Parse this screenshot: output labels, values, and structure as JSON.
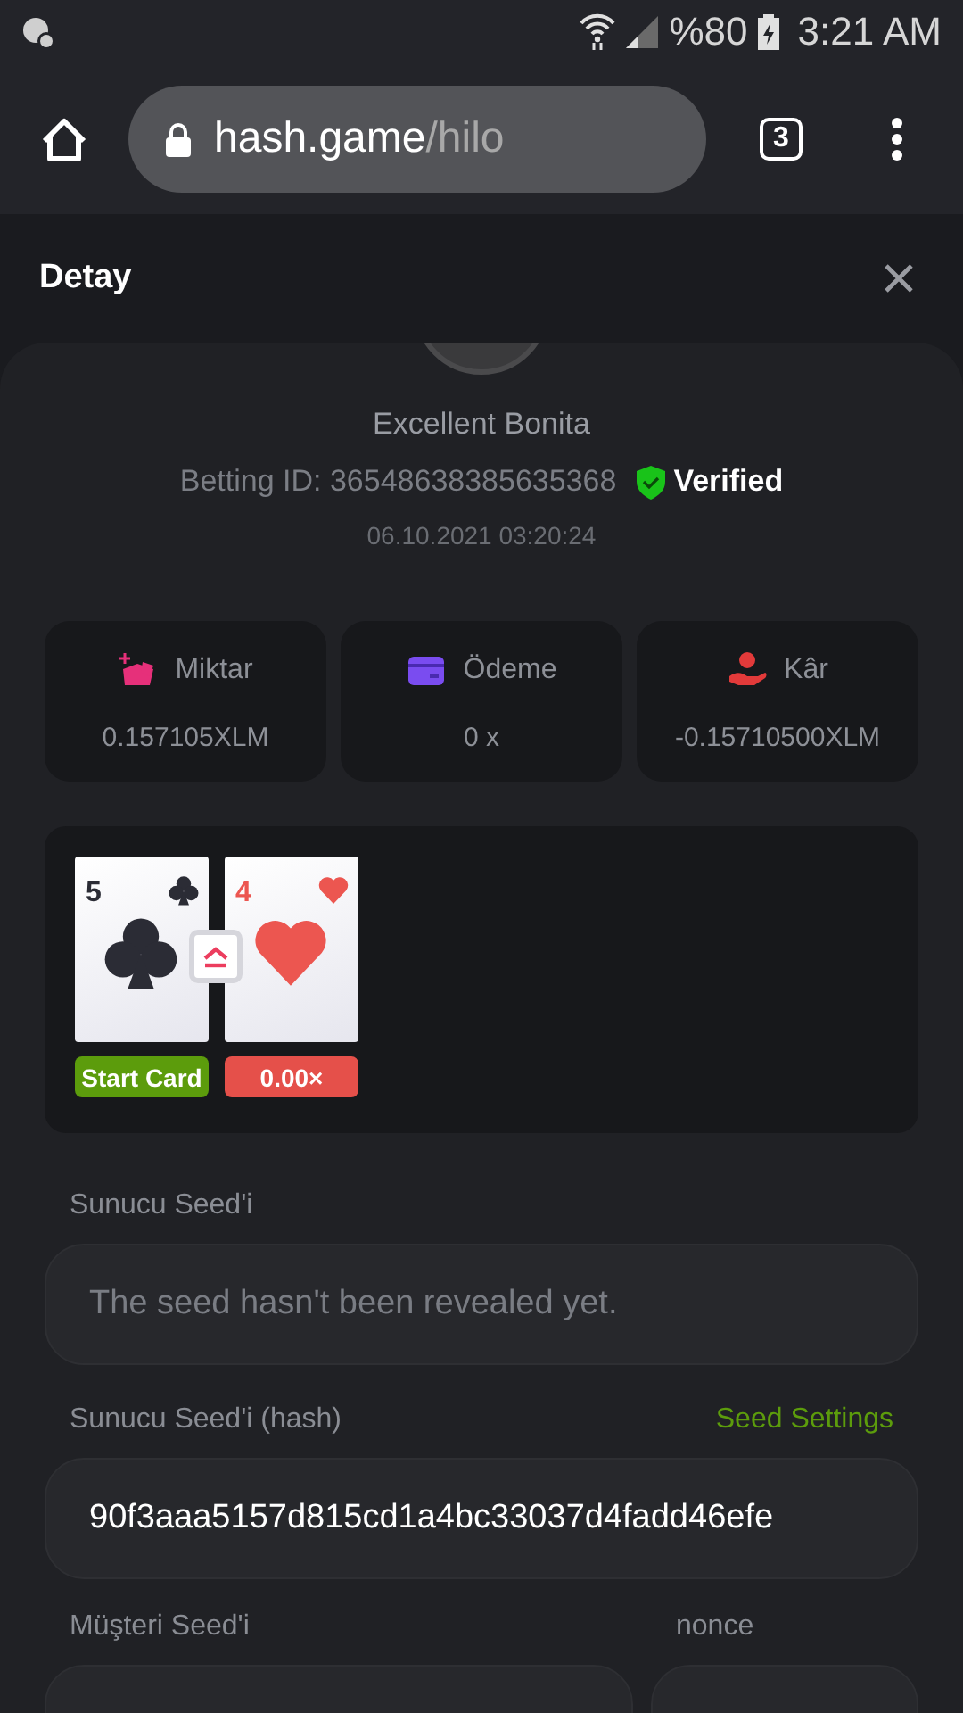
{
  "status_bar": {
    "battery": "%80",
    "time": "3:21 AM"
  },
  "browser": {
    "url_host": "hash.game",
    "url_path": "/hilo",
    "tab_count": "3"
  },
  "header": {
    "title": "Detay"
  },
  "player": {
    "name": "Excellent Bonita",
    "betting_id": "Betting ID: 36548638385635368",
    "verified": "Verified",
    "date": "06.10.2021 03:20:24"
  },
  "stats": [
    {
      "kind": "amount",
      "label": "Miktar",
      "value": "0.157105XLM"
    },
    {
      "kind": "payout",
      "label": "Ödeme",
      "value": "0 x"
    },
    {
      "kind": "profit",
      "label": "Kâr",
      "value": "-0.15710500XLM"
    }
  ],
  "cards": [
    {
      "kind": "clubs",
      "rank": "5",
      "badge": "Start Card",
      "color": "#5c9c0c"
    },
    {
      "kind": "hearts",
      "rank": "4",
      "badge": "0.00×",
      "color": "#e5504a"
    }
  ],
  "server_seed": {
    "label": "Sunucu Seed'i",
    "placeholder": "The seed hasn't been revealed yet."
  },
  "server_seed_hash": {
    "label": "Sunucu Seed'i (hash)",
    "link": "Seed Settings",
    "value": "90f3aaa5157d815cd1a4bc33037d4fadd46efe"
  },
  "client_seed": {
    "label": "Müşteri Seed'i"
  },
  "nonce": {
    "label": "nonce"
  }
}
